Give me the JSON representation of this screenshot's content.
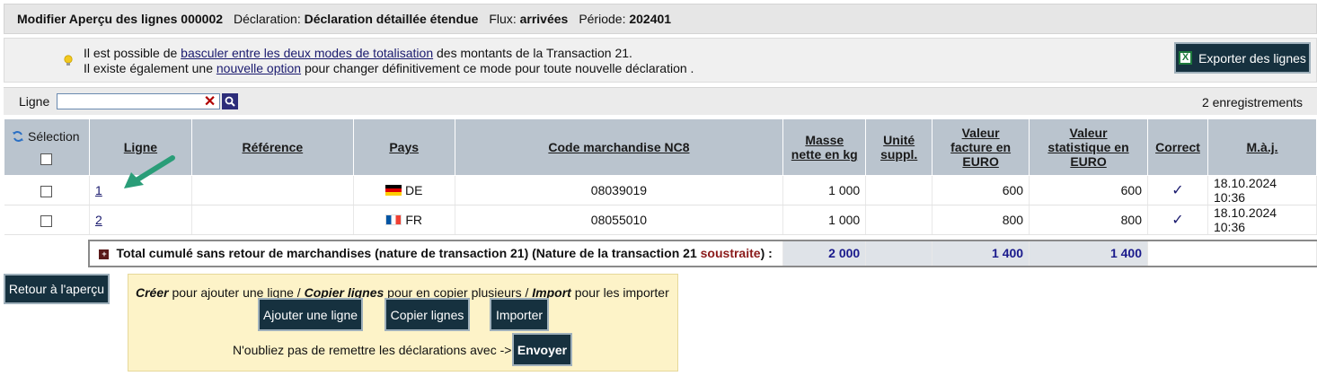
{
  "title_bar": {
    "prefix": "Modifier Aperçu des lignes 000002",
    "declaration_label": "Déclaration",
    "declaration_value": "Déclaration détaillée étendue",
    "flux_label": "Flux",
    "flux_value": "arrivées",
    "periode_label": "Période",
    "periode_value": "202401"
  },
  "info": {
    "line1_pre": "Il est possible de ",
    "line1_link": "basculer entre les deux modes de totalisation",
    "line1_post": " des montants de la Transaction 21.",
    "line2_pre": "Il existe également une ",
    "line2_link": "nouvelle option",
    "line2_post": " pour changer définitivement ce mode pour toute nouvelle déclaration ."
  },
  "export_button": {
    "label": "Exporter des lignes",
    "icon": "excel-icon"
  },
  "filter": {
    "label": "Ligne",
    "value": "",
    "placeholder": "",
    "record_count": "2 enregistrements"
  },
  "table": {
    "headers": {
      "selection": "Sélection",
      "ligne": "Ligne",
      "reference": "Référence",
      "pays": "Pays",
      "code": "Code marchandise NC8",
      "masse_1": "Masse",
      "masse_2": "nette en kg",
      "unite_1": "Unité",
      "unite_2": "suppl.",
      "valeur_facture_1": "Valeur",
      "valeur_facture_2": "facture en",
      "valeur_facture_3": "EURO",
      "valeur_stat_1": "Valeur",
      "valeur_stat_2": "statistique en",
      "valeur_stat_3": "EURO",
      "correct": "Correct",
      "maj": "M.à.j."
    },
    "rows": [
      {
        "ligne": "1",
        "reference": "",
        "pays": "DE",
        "code": "08039019",
        "masse": "1 000",
        "unite": "",
        "valeur_facture": "600",
        "valeur_stat": "600",
        "correct": "✓",
        "maj": "18.10.2024 10:36"
      },
      {
        "ligne": "2",
        "reference": "",
        "pays": "FR",
        "code": "08055010",
        "masse": "1 000",
        "unite": "",
        "valeur_facture": "800",
        "valeur_stat": "800",
        "correct": "✓",
        "maj": "18.10.2024 10:36"
      }
    ],
    "total": {
      "label_pre": "Total cumulé sans retour de marchandises (nature de transaction 21) (Nature de la transaction 21 ",
      "label_sous": "soustraite",
      "label_post": ") :",
      "masse": "2 000",
      "valeur_facture": "1 400",
      "valeur_stat": "1 400"
    }
  },
  "back_button": "Retour à l'aperçu",
  "actions": {
    "creer": "Créer",
    "txt1": " pour ajouter une ligne / ",
    "copier": "Copier lignes",
    "txt2": " pour en copier plusieurs / ",
    "import": "Import",
    "txt3": " pour les importer",
    "btn_add": "Ajouter une ligne",
    "btn_copy": "Copier lignes",
    "btn_import": "Importer",
    "reminder": "N'oubliez pas de remettre les déclarations avec ->",
    "btn_send": "Envoyer"
  },
  "colors": {
    "dark_button": "#16313f",
    "header_bg": "#bac4ce",
    "info_bg": "#fdf3c8",
    "arrow": "#2a9d78"
  }
}
